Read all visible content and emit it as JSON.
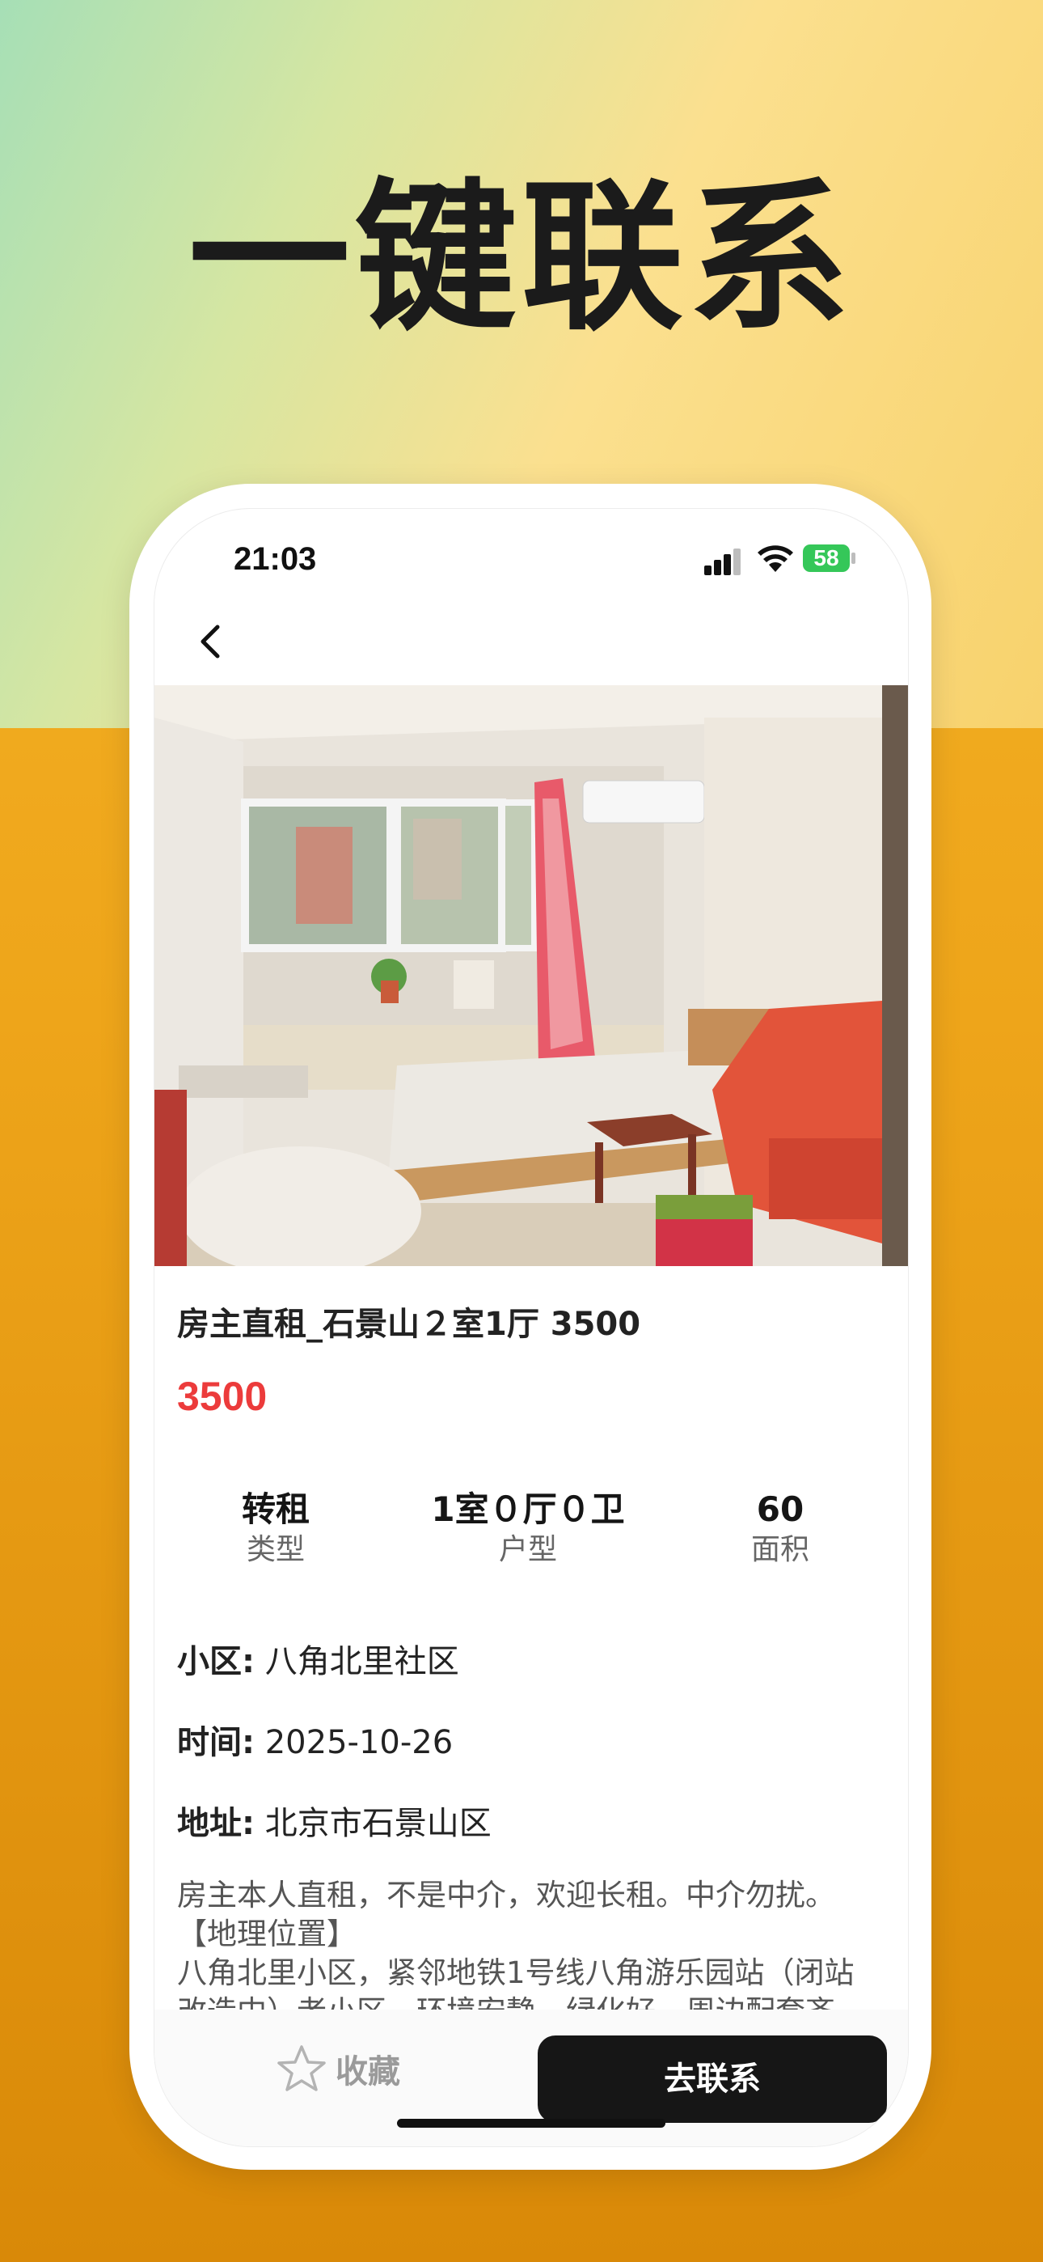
{
  "promo": {
    "headline": "一键联系"
  },
  "status_bar": {
    "time": "21:03",
    "battery": "58"
  },
  "listing": {
    "title": "房主直租_石景山２室1厅 3500",
    "price": "3500",
    "stats": [
      {
        "value": "转租",
        "label": "类型"
      },
      {
        "value": "1室０厅０卫",
        "label": "户型"
      },
      {
        "value": "60",
        "label": "面积"
      }
    ],
    "info": [
      {
        "key": "小区:",
        "value": "八角北里社区"
      },
      {
        "key": "时间:",
        "value": "2025-10-26"
      },
      {
        "key": "地址:",
        "value": "北京市石景山区"
      }
    ],
    "description": [
      "房主本人直租，不是中介，欢迎长租。中介勿扰。",
      "【地理位置】",
      "八角北里小区，紧邻地铁1号线八角游乐园站（闭站",
      "改造中）老小区，环境安静，绿化好，周边配套齐"
    ]
  },
  "bottom_bar": {
    "favorite_label": "收藏",
    "contact_label": "去联系"
  },
  "colors": {
    "price": "#ec3b3b",
    "button": "#161616",
    "battery": "#35c759"
  }
}
